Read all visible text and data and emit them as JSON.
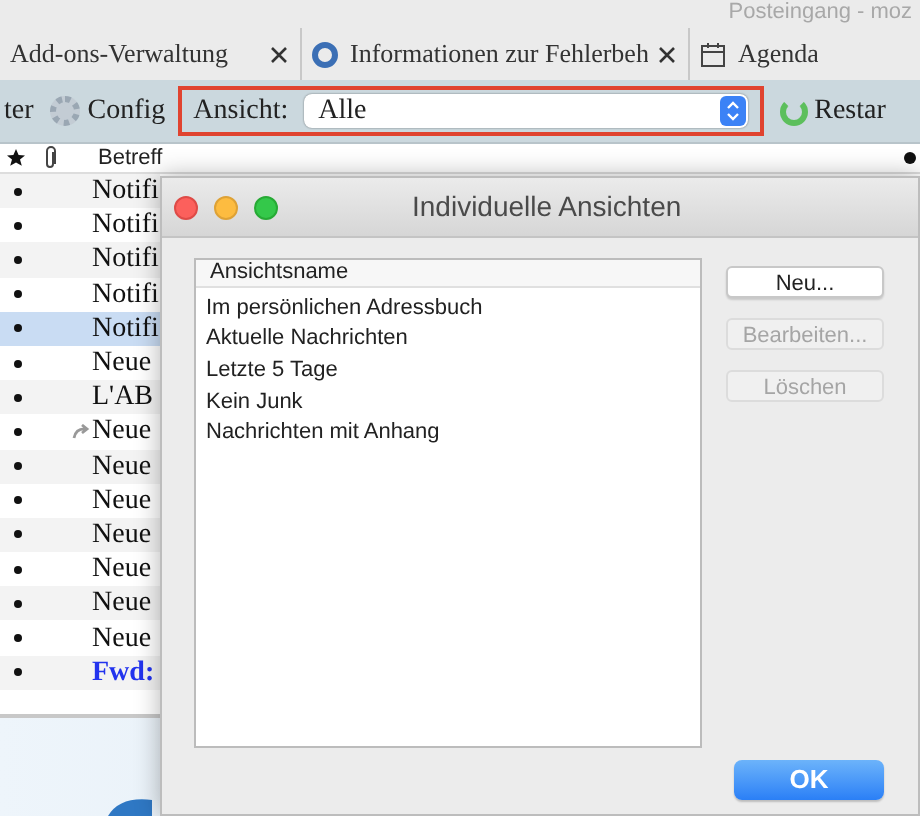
{
  "window": {
    "title": "Posteingang - moz"
  },
  "tabs": [
    {
      "kind": "plain",
      "label": "Add-ons-Verwaltung",
      "closable": true
    },
    {
      "kind": "support",
      "label": "Informationen zur Fehlerbeh",
      "closable": true
    },
    {
      "kind": "calendar",
      "label": "Agenda",
      "closable": false
    }
  ],
  "toolbar": [
    {
      "kind": "button",
      "label": "ter"
    },
    {
      "kind": "gear-button",
      "label": "Config"
    },
    {
      "kind": "view-select",
      "label": "Ansicht:",
      "value": "Alle",
      "highlighted": true
    },
    {
      "kind": "refresh-button",
      "label": "Restar"
    }
  ],
  "message_list": {
    "column": "Betreff",
    "rows": [
      {
        "subject": "Notifi",
        "selected": false,
        "replied": false,
        "color": "#111111"
      },
      {
        "subject": "Notifi",
        "selected": false,
        "replied": false,
        "color": "#111111"
      },
      {
        "subject": "Notifi",
        "selected": false,
        "replied": false,
        "color": "#111111"
      },
      {
        "subject": "Notifi",
        "selected": false,
        "replied": false,
        "color": "#111111"
      },
      {
        "subject": "Notifi",
        "selected": true,
        "replied": false,
        "color": "#111111"
      },
      {
        "subject": "Neue",
        "selected": false,
        "replied": false,
        "color": "#111111"
      },
      {
        "subject": "L'AB",
        "selected": false,
        "replied": false,
        "color": "#111111"
      },
      {
        "subject": "Neue",
        "selected": false,
        "replied": true,
        "color": "#111111"
      },
      {
        "subject": "Neue",
        "selected": false,
        "replied": false,
        "color": "#111111"
      },
      {
        "subject": "Neue",
        "selected": false,
        "replied": false,
        "color": "#111111"
      },
      {
        "subject": "Neue",
        "selected": false,
        "replied": false,
        "color": "#111111"
      },
      {
        "subject": "Neue",
        "selected": false,
        "replied": false,
        "color": "#111111"
      },
      {
        "subject": "Neue",
        "selected": false,
        "replied": false,
        "color": "#111111"
      },
      {
        "subject": "Neue",
        "selected": false,
        "replied": false,
        "color": "#111111"
      },
      {
        "subject": "Fwd:",
        "selected": false,
        "replied": false,
        "color": "#2233ee"
      }
    ]
  },
  "dialog": {
    "title": "Individuelle Ansichten",
    "list": {
      "header": "Ansichtsname",
      "items": [
        "Im persönlichen Adressbuch",
        "Aktuelle Nachrichten",
        "Letzte 5 Tage",
        "Kein Junk",
        "Nachrichten mit Anhang"
      ]
    },
    "buttons": [
      {
        "label": "Neu...",
        "disabled": false
      },
      {
        "label": "Bearbeiten...",
        "disabled": true
      },
      {
        "label": "Löschen",
        "disabled": true
      }
    ],
    "ok_button": "OK"
  }
}
